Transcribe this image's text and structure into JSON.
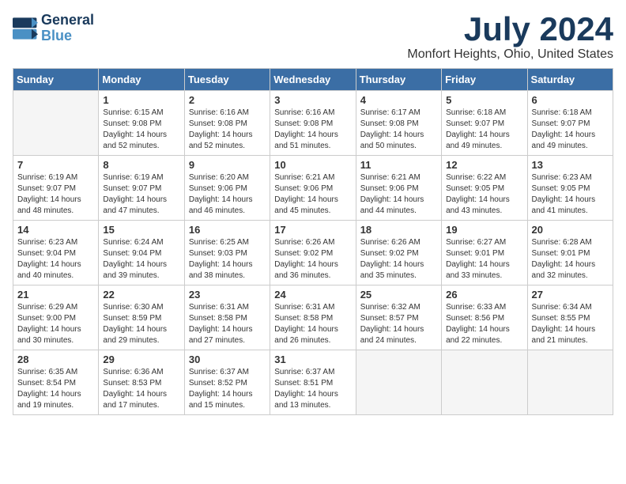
{
  "logo": {
    "line1": "General",
    "line2": "Blue"
  },
  "title": "July 2024",
  "subtitle": "Monfort Heights, Ohio, United States",
  "weekdays": [
    "Sunday",
    "Monday",
    "Tuesday",
    "Wednesday",
    "Thursday",
    "Friday",
    "Saturday"
  ],
  "weeks": [
    [
      {
        "day": "",
        "empty": true
      },
      {
        "day": "1",
        "sunrise": "6:15 AM",
        "sunset": "9:08 PM",
        "daylight": "14 hours and 52 minutes."
      },
      {
        "day": "2",
        "sunrise": "6:16 AM",
        "sunset": "9:08 PM",
        "daylight": "14 hours and 52 minutes."
      },
      {
        "day": "3",
        "sunrise": "6:16 AM",
        "sunset": "9:08 PM",
        "daylight": "14 hours and 51 minutes."
      },
      {
        "day": "4",
        "sunrise": "6:17 AM",
        "sunset": "9:08 PM",
        "daylight": "14 hours and 50 minutes."
      },
      {
        "day": "5",
        "sunrise": "6:18 AM",
        "sunset": "9:07 PM",
        "daylight": "14 hours and 49 minutes."
      },
      {
        "day": "6",
        "sunrise": "6:18 AM",
        "sunset": "9:07 PM",
        "daylight": "14 hours and 49 minutes."
      }
    ],
    [
      {
        "day": "7",
        "sunrise": "6:19 AM",
        "sunset": "9:07 PM",
        "daylight": "14 hours and 48 minutes."
      },
      {
        "day": "8",
        "sunrise": "6:19 AM",
        "sunset": "9:07 PM",
        "daylight": "14 hours and 47 minutes."
      },
      {
        "day": "9",
        "sunrise": "6:20 AM",
        "sunset": "9:06 PM",
        "daylight": "14 hours and 46 minutes."
      },
      {
        "day": "10",
        "sunrise": "6:21 AM",
        "sunset": "9:06 PM",
        "daylight": "14 hours and 45 minutes."
      },
      {
        "day": "11",
        "sunrise": "6:21 AM",
        "sunset": "9:06 PM",
        "daylight": "14 hours and 44 minutes."
      },
      {
        "day": "12",
        "sunrise": "6:22 AM",
        "sunset": "9:05 PM",
        "daylight": "14 hours and 43 minutes."
      },
      {
        "day": "13",
        "sunrise": "6:23 AM",
        "sunset": "9:05 PM",
        "daylight": "14 hours and 41 minutes."
      }
    ],
    [
      {
        "day": "14",
        "sunrise": "6:23 AM",
        "sunset": "9:04 PM",
        "daylight": "14 hours and 40 minutes."
      },
      {
        "day": "15",
        "sunrise": "6:24 AM",
        "sunset": "9:04 PM",
        "daylight": "14 hours and 39 minutes."
      },
      {
        "day": "16",
        "sunrise": "6:25 AM",
        "sunset": "9:03 PM",
        "daylight": "14 hours and 38 minutes."
      },
      {
        "day": "17",
        "sunrise": "6:26 AM",
        "sunset": "9:02 PM",
        "daylight": "14 hours and 36 minutes."
      },
      {
        "day": "18",
        "sunrise": "6:26 AM",
        "sunset": "9:02 PM",
        "daylight": "14 hours and 35 minutes."
      },
      {
        "day": "19",
        "sunrise": "6:27 AM",
        "sunset": "9:01 PM",
        "daylight": "14 hours and 33 minutes."
      },
      {
        "day": "20",
        "sunrise": "6:28 AM",
        "sunset": "9:01 PM",
        "daylight": "14 hours and 32 minutes."
      }
    ],
    [
      {
        "day": "21",
        "sunrise": "6:29 AM",
        "sunset": "9:00 PM",
        "daylight": "14 hours and 30 minutes."
      },
      {
        "day": "22",
        "sunrise": "6:30 AM",
        "sunset": "8:59 PM",
        "daylight": "14 hours and 29 minutes."
      },
      {
        "day": "23",
        "sunrise": "6:31 AM",
        "sunset": "8:58 PM",
        "daylight": "14 hours and 27 minutes."
      },
      {
        "day": "24",
        "sunrise": "6:31 AM",
        "sunset": "8:58 PM",
        "daylight": "14 hours and 26 minutes."
      },
      {
        "day": "25",
        "sunrise": "6:32 AM",
        "sunset": "8:57 PM",
        "daylight": "14 hours and 24 minutes."
      },
      {
        "day": "26",
        "sunrise": "6:33 AM",
        "sunset": "8:56 PM",
        "daylight": "14 hours and 22 minutes."
      },
      {
        "day": "27",
        "sunrise": "6:34 AM",
        "sunset": "8:55 PM",
        "daylight": "14 hours and 21 minutes."
      }
    ],
    [
      {
        "day": "28",
        "sunrise": "6:35 AM",
        "sunset": "8:54 PM",
        "daylight": "14 hours and 19 minutes."
      },
      {
        "day": "29",
        "sunrise": "6:36 AM",
        "sunset": "8:53 PM",
        "daylight": "14 hours and 17 minutes."
      },
      {
        "day": "30",
        "sunrise": "6:37 AM",
        "sunset": "8:52 PM",
        "daylight": "14 hours and 15 minutes."
      },
      {
        "day": "31",
        "sunrise": "6:37 AM",
        "sunset": "8:51 PM",
        "daylight": "14 hours and 13 minutes."
      },
      {
        "day": "",
        "empty": true
      },
      {
        "day": "",
        "empty": true
      },
      {
        "day": "",
        "empty": true
      }
    ]
  ]
}
